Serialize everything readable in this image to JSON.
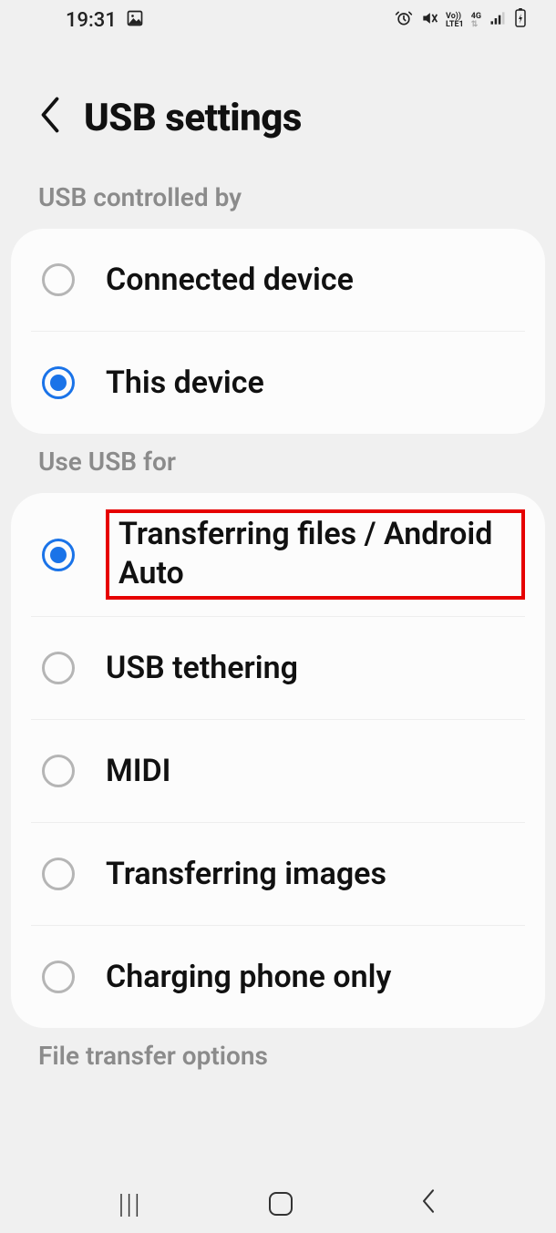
{
  "status_bar": {
    "time": "19:31",
    "image_icon": "🖼",
    "alarm_icon": "⏰",
    "mute_icon": "🔇",
    "volte_top": "Vo))",
    "volte_bottom": "LTE1",
    "data_label": "4G",
    "arrows": "⇅",
    "signal_icon": "📶",
    "battery_icon": "🔋"
  },
  "header": {
    "title": "USB settings"
  },
  "sections": {
    "controlled_by": {
      "title": "USB controlled by",
      "options": [
        {
          "label": "Connected device",
          "selected": false
        },
        {
          "label": "This device",
          "selected": true
        }
      ]
    },
    "use_for": {
      "title": "Use USB for",
      "options": [
        {
          "label": "Transferring files / Android Auto",
          "selected": true,
          "highlighted": true
        },
        {
          "label": "USB tethering",
          "selected": false
        },
        {
          "label": "MIDI",
          "selected": false
        },
        {
          "label": "Transferring images",
          "selected": false
        },
        {
          "label": "Charging phone only",
          "selected": false
        }
      ]
    },
    "file_transfer": {
      "title": "File transfer options"
    }
  }
}
